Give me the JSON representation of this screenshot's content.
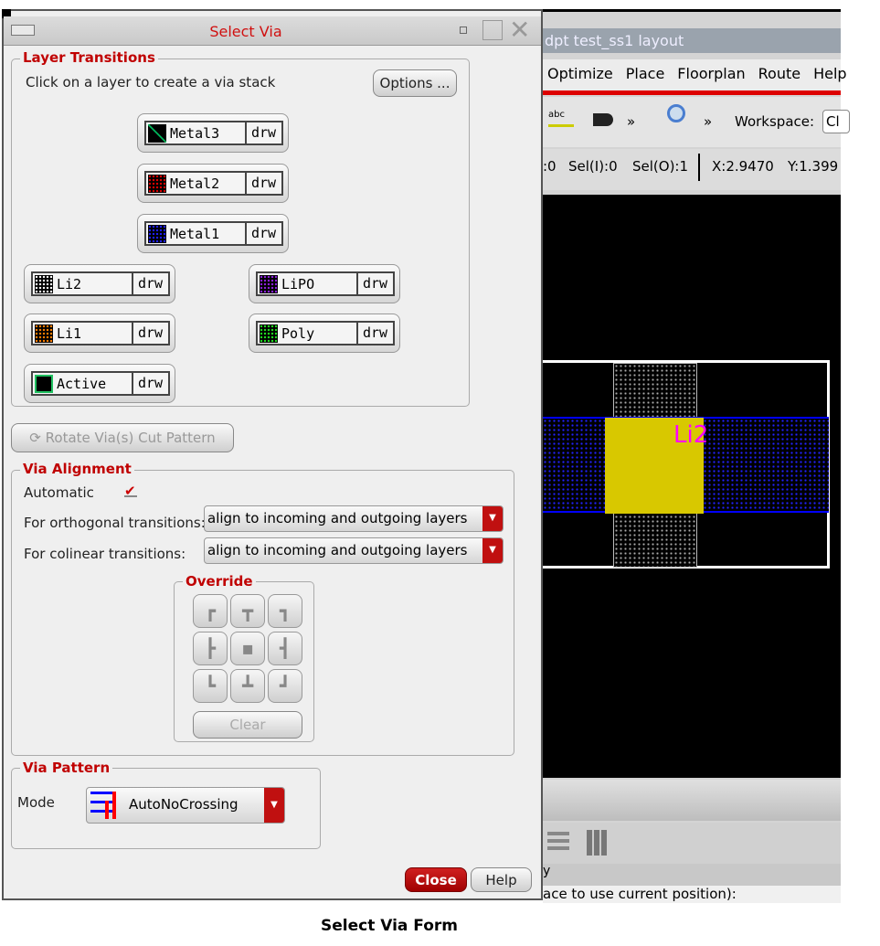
{
  "background_app": {
    "title": "dpt test_ss1 layout",
    "menu": [
      "Optimize",
      "Place",
      "Floorplan",
      "Route",
      "Help"
    ],
    "toolbar": {
      "more1": "»",
      "more2": "»",
      "workspace_label": "Workspace:",
      "workspace_value": "Cl"
    },
    "status": {
      "sel_partial": ":0",
      "sel_i": "Sel(I):0",
      "sel_o": "Sel(O):1",
      "x": "X:2.9470",
      "y": "Y:1.399"
    },
    "canvas": {
      "label": "Li2"
    },
    "prompt_partial": "y",
    "command_hint": "ace to use current position):"
  },
  "dialog": {
    "title": "Select Via",
    "layer_transitions": {
      "legend": "Layer Transitions",
      "instruction": "Click on a layer to create a via stack",
      "options_label": "Options ...",
      "layers": [
        {
          "name": "Metal3",
          "purpose": "drw",
          "color": "#00c060"
        },
        {
          "name": "Metal2",
          "purpose": "drw",
          "color": "#e00000"
        },
        {
          "name": "Metal1",
          "purpose": "drw",
          "color": "#2020ff"
        },
        {
          "name": "Li2",
          "purpose": "drw",
          "color": "#ffffff"
        },
        {
          "name": "LiPO",
          "purpose": "drw",
          "color": "#9020e0"
        },
        {
          "name": "Li1",
          "purpose": "drw",
          "color": "#ff8000"
        },
        {
          "name": "Poly",
          "purpose": "drw",
          "color": "#20e020"
        },
        {
          "name": "Active",
          "purpose": "drw",
          "color": "#20c060"
        }
      ]
    },
    "rotate_label": "Rotate Via(s) Cut Pattern",
    "via_alignment": {
      "legend": "Via Alignment",
      "automatic_label": "Automatic",
      "automatic_checked": true,
      "orthogonal_label": "For orthogonal transitions:",
      "orthogonal_value": "align to incoming and outgoing layers",
      "colinear_label": "For colinear transitions:",
      "colinear_value": "align to incoming and outgoing layers",
      "override": {
        "legend": "Override",
        "clear_label": "Clear"
      }
    },
    "via_pattern": {
      "legend": "Via Pattern",
      "mode_label": "Mode",
      "mode_value": "AutoNoCrossing"
    },
    "close_label": "Close",
    "help_label": "Help"
  },
  "caption": "Select Via Form",
  "colors": {
    "accent": "#c00000",
    "canvas": "#000000",
    "metal1": "#0000ff",
    "li2": "#e0d000"
  }
}
